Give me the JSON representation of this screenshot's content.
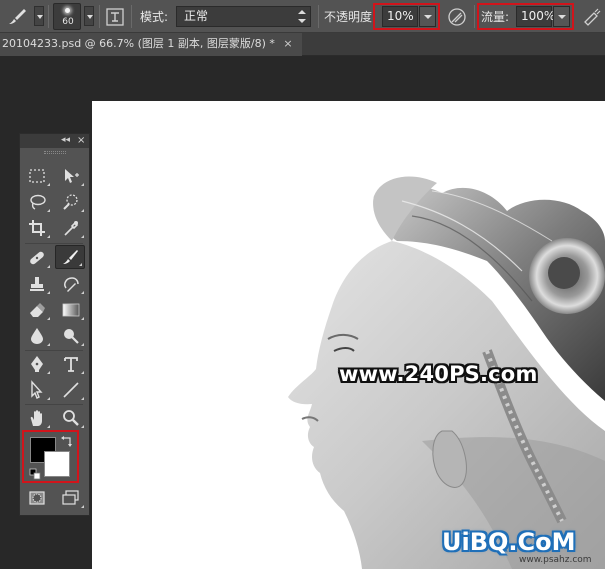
{
  "options_bar": {
    "brush_size": "60",
    "mode_label": "模式:",
    "mode_value": "正常",
    "opacity_label": "不透明度:",
    "opacity_value": "10%",
    "flow_label": "流量:",
    "flow_value": "100%",
    "highlight_color": "#d1141b"
  },
  "document_tab": {
    "title": "20104233.psd @ 66.7% (图层 1 副本, 图层蒙版/8) *",
    "close_glyph": "×"
  },
  "tools_panel": {
    "collapse_glyph": "◂◂",
    "close_glyph": "×",
    "tools": [
      {
        "name": "rectangular-marquee",
        "icon": "marquee-icon"
      },
      {
        "name": "move",
        "icon": "move-icon"
      },
      {
        "name": "lasso",
        "icon": "lasso-icon"
      },
      {
        "name": "quick-selection",
        "icon": "quick-select-icon"
      },
      {
        "name": "crop",
        "icon": "crop-icon"
      },
      {
        "name": "eyedropper",
        "icon": "eyedropper-icon"
      },
      {
        "name": "spot-healing",
        "icon": "bandage-icon"
      },
      {
        "name": "brush",
        "icon": "brush-icon",
        "active": true
      },
      {
        "name": "clone-stamp",
        "icon": "stamp-icon"
      },
      {
        "name": "history-brush",
        "icon": "history-brush-icon"
      },
      {
        "name": "eraser",
        "icon": "eraser-icon"
      },
      {
        "name": "gradient",
        "icon": "gradient-icon"
      },
      {
        "name": "blur",
        "icon": "blur-icon"
      },
      {
        "name": "dodge",
        "icon": "dodge-icon"
      },
      {
        "name": "pen",
        "icon": "pen-icon"
      },
      {
        "name": "type",
        "icon": "type-icon",
        "glyph": "T"
      },
      {
        "name": "path-selection",
        "icon": "path-select-icon"
      },
      {
        "name": "line",
        "icon": "line-icon"
      },
      {
        "name": "hand",
        "icon": "hand-icon"
      },
      {
        "name": "zoom",
        "icon": "zoom-icon"
      }
    ],
    "foreground_color": "#000000",
    "background_color": "#ffffff",
    "highlight_color": "#d1141b"
  },
  "canvas": {
    "watermark_text": "www.240PS.com",
    "brand_text": "UiBQ.CoM",
    "brand_url": "www.psahz.com"
  }
}
